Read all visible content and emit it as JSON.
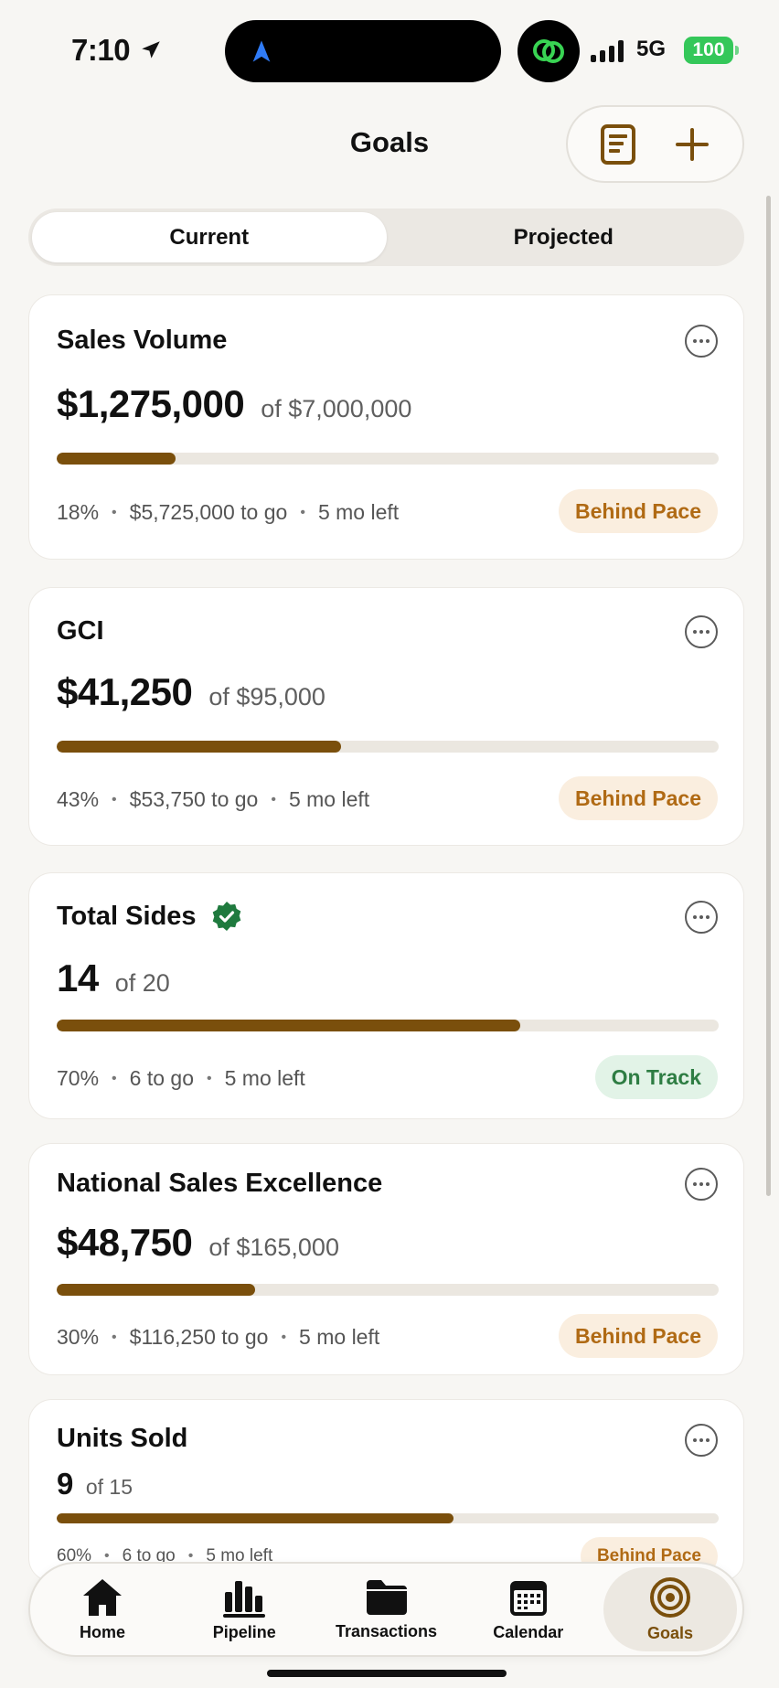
{
  "status_bar": {
    "time": "7:10",
    "network": "5G",
    "battery": "100"
  },
  "header": {
    "title": "Goals"
  },
  "segmented": {
    "current": "Current",
    "projected": "Projected"
  },
  "goals": [
    {
      "title": "Sales Volume",
      "amount": "$1,275,000",
      "of": "of $7,000,000",
      "progress": 0.18,
      "percent": "18%",
      "to_go": "$5,725,000 to go",
      "left": "5 mo left",
      "status": "Behind Pace"
    },
    {
      "title": "GCI",
      "amount": "$41,250",
      "of": "of $95,000",
      "progress": 0.43,
      "percent": "43%",
      "to_go": "$53,750 to go",
      "left": "5 mo left",
      "status": "Behind Pace"
    },
    {
      "title": "Total Sides",
      "amount": "14",
      "of": "of 20",
      "progress": 0.7,
      "percent": "70%",
      "to_go": "6 to go",
      "left": "5 mo left",
      "status": "On Track"
    },
    {
      "title": "National Sales Excellence",
      "amount": "$48,750",
      "of": "of $165,000",
      "progress": 0.3,
      "percent": "30%",
      "to_go": "$116,250 to go",
      "left": "5 mo left",
      "status": "Behind Pace"
    },
    {
      "title": "Units Sold",
      "amount": "9",
      "of": "of 15",
      "progress": 0.6,
      "percent": "60%",
      "to_go": "6 to go",
      "left": "5 mo left",
      "status": "Behind Pace"
    }
  ],
  "separator": "•",
  "tabbar": [
    {
      "label": "Home",
      "icon": "home-icon"
    },
    {
      "label": "Pipeline",
      "icon": "pipeline-icon"
    },
    {
      "label": "Transactions",
      "icon": "folder-icon"
    },
    {
      "label": "Calendar",
      "icon": "calendar-icon"
    },
    {
      "label": "Goals",
      "icon": "target-icon"
    }
  ],
  "colors": {
    "accent": "#7a4f0c",
    "behind": "#b06a14",
    "on_track": "#2e7d43",
    "verified": "#1f7a3e"
  }
}
